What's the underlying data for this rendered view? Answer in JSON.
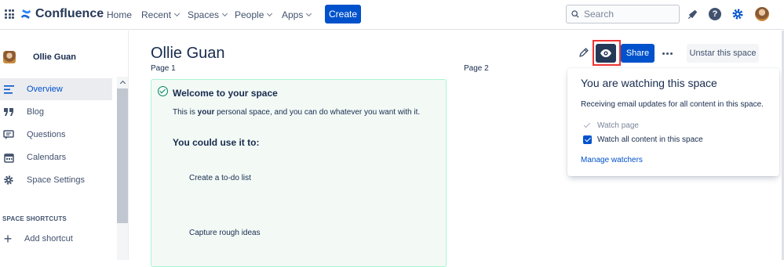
{
  "nav": {
    "logo": "Confluence",
    "items": [
      "Home",
      "Recent",
      "Spaces",
      "People",
      "Apps"
    ],
    "create": "Create",
    "search_placeholder": "Search",
    "help": "?"
  },
  "sidebar": {
    "profile_name": "Ollie Guan",
    "items": [
      {
        "label": "Overview",
        "icon": "overview-icon"
      },
      {
        "label": "Blog",
        "icon": "quote-icon"
      },
      {
        "label": "Questions",
        "icon": "questions-icon"
      },
      {
        "label": "Calendars",
        "icon": "calendar-icon"
      },
      {
        "label": "Space Settings",
        "icon": "gear-icon"
      }
    ],
    "shortcuts_header": "SPACE SHORTCUTS",
    "add_shortcut": "Add shortcut"
  },
  "page": {
    "title": "Ollie Guan",
    "col1": "Page 1",
    "col2": "Page 2",
    "panel": {
      "title": "Welcome to your space",
      "text_before": "This is ",
      "text_bold": "your",
      "text_after": " personal space, and you can do whatever you want with it.",
      "subheading": "You could use it to:",
      "items": [
        "Create a to-do list",
        "Capture rough ideas"
      ]
    }
  },
  "toolbar": {
    "share": "Share",
    "unstar": "Unstar this space"
  },
  "watch_popup": {
    "title": "You are watching this space",
    "description": "Receiving email updates for all content in this space.",
    "options": [
      {
        "label": "Watch page",
        "checked": true,
        "disabled": true
      },
      {
        "label": "Watch all content in this space",
        "checked": true,
        "disabled": false
      }
    ],
    "manage_link": "Manage watchers"
  },
  "colors": {
    "primary": "#0052cc",
    "watch_button": "#253858",
    "highlight": "#ee3333",
    "panel_bg": "#f3faf6",
    "panel_border": "#abf5d1"
  }
}
